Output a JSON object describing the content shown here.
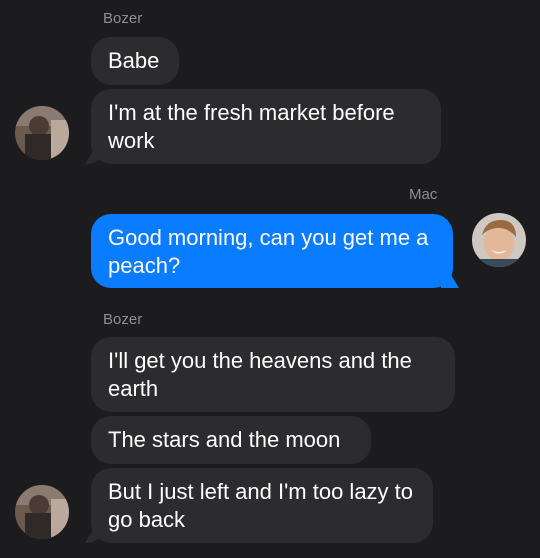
{
  "thread": {
    "messages": [
      {
        "sender": "Bozer",
        "text": "Babe"
      },
      {
        "text": "I'm at the fresh market before work"
      },
      {
        "sender": "Mac",
        "text": "Good morning, can you get me a peach?"
      },
      {
        "sender": "Bozer",
        "text": "I'll get you the heavens and the earth"
      },
      {
        "text": "The stars and the moon"
      },
      {
        "text": "But I just left and I'm too lazy to go back"
      }
    ]
  },
  "colors": {
    "background": "#1c1c1e",
    "incoming_bubble": "#2c2c2e",
    "outgoing_bubble": "#0a7cff",
    "sender_label": "#8e8e93"
  },
  "icons": {
    "bozer_avatar": "bozer-avatar-icon",
    "mac_avatar": "mac-avatar-icon"
  }
}
